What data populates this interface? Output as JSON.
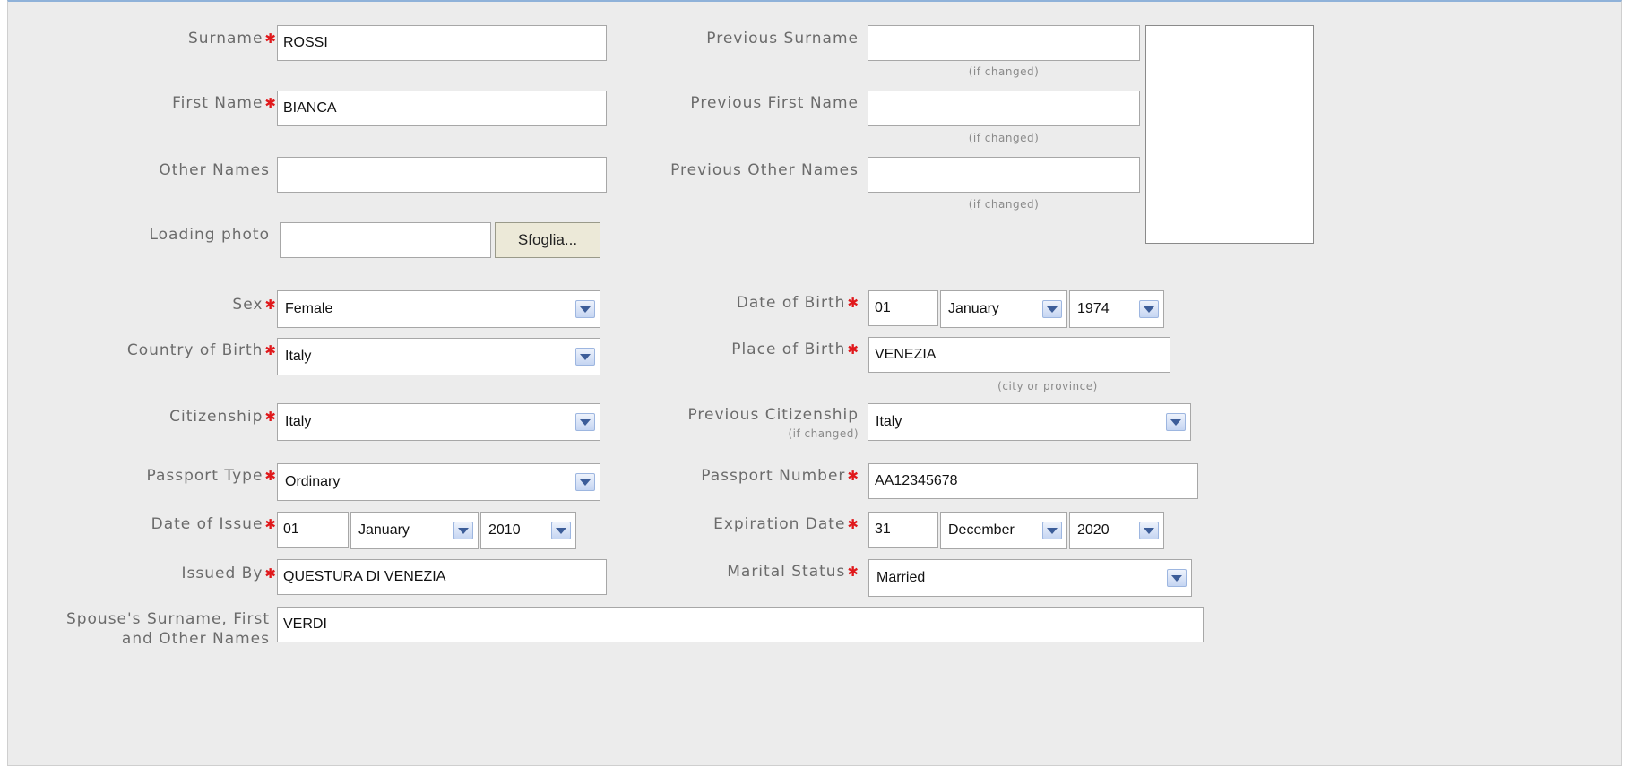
{
  "fields": {
    "surname": {
      "label": "Surname",
      "value": "ROSSI"
    },
    "first_name": {
      "label": "First Name",
      "value": "BIANCA"
    },
    "other_names": {
      "label": "Other Names",
      "value": ""
    },
    "loading_photo": {
      "label": "Loading photo",
      "value": "",
      "button": "Sfoglia..."
    },
    "previous_surname": {
      "label": "Previous Surname",
      "value": "",
      "note": "(if changed)"
    },
    "previous_first_name": {
      "label": "Previous First Name",
      "value": "",
      "note": "(if changed)"
    },
    "previous_other_names": {
      "label": "Previous Other Names",
      "value": "",
      "note": "(if changed)"
    },
    "sex": {
      "label": "Sex",
      "value": "Female"
    },
    "date_of_birth": {
      "label": "Date of Birth",
      "day": "01",
      "month": "January",
      "year": "1974"
    },
    "country_of_birth": {
      "label": "Country of Birth",
      "value": "Italy"
    },
    "place_of_birth": {
      "label": "Place of Birth",
      "value": "VENEZIA",
      "note": "(city or province)"
    },
    "citizenship": {
      "label": "Citizenship",
      "value": "Italy"
    },
    "previous_citizenship": {
      "label": "Previous Citizenship",
      "note": "(if changed)",
      "value": "Italy"
    },
    "passport_type": {
      "label": "Passport Type",
      "value": "Ordinary"
    },
    "passport_number": {
      "label": "Passport Number",
      "value": "AA12345678"
    },
    "date_of_issue": {
      "label": "Date of Issue",
      "day": "01",
      "month": "January",
      "year": "2010"
    },
    "expiration_date": {
      "label": "Expiration Date",
      "day": "31",
      "month": "December",
      "year": "2020"
    },
    "issued_by": {
      "label": "Issued By",
      "value": "QUESTURA DI VENEZIA"
    },
    "marital_status": {
      "label": "Marital Status",
      "value": "Married"
    },
    "spouse_names": {
      "label_line1": "Spouse's Surname, First",
      "label_line2": "and Other Names",
      "value": "VERDI"
    }
  },
  "required_marker": "✱",
  "colors": {
    "background": "#ececec",
    "required": "#e0181b",
    "top_border": "#8fb2d9",
    "arrow_button": "#c5d5f2"
  }
}
